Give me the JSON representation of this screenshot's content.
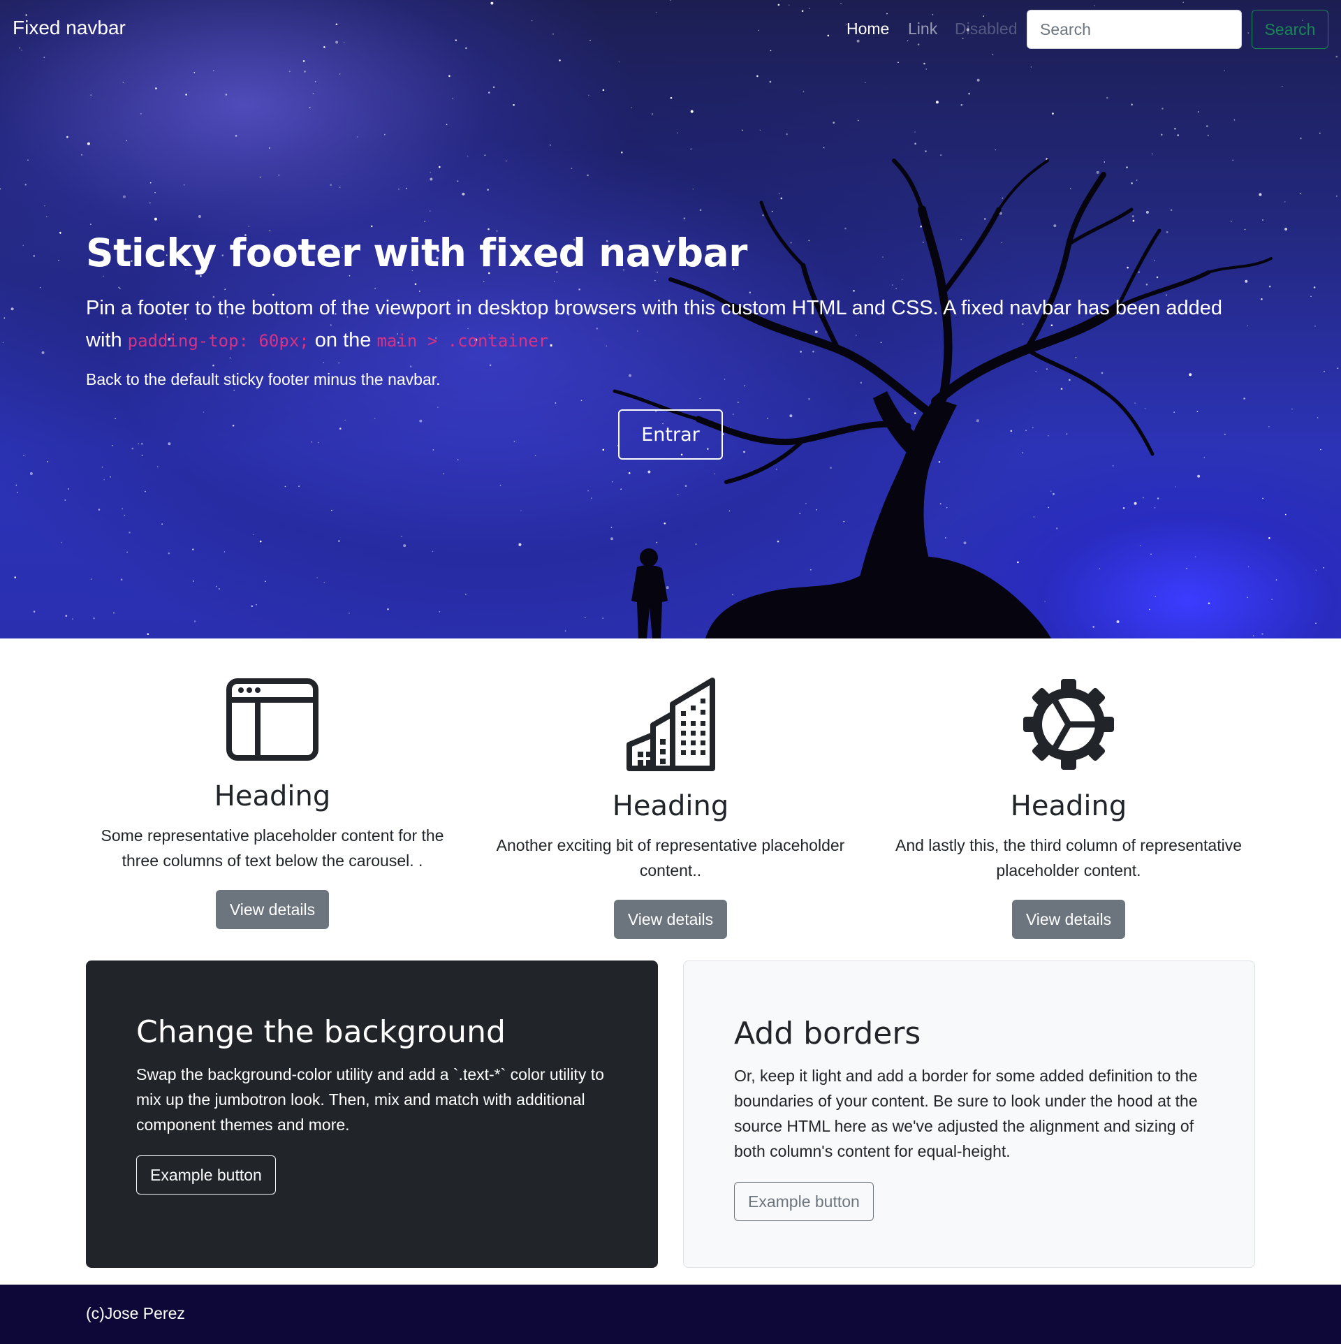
{
  "navbar": {
    "brand": "Fixed navbar",
    "links": [
      {
        "label": "Home",
        "state": "active"
      },
      {
        "label": "Link",
        "state": "normal"
      },
      {
        "label": "Disabled",
        "state": "disabled"
      }
    ],
    "search_placeholder": "Search",
    "search_button": "Search"
  },
  "hero": {
    "title": "Sticky footer with fixed navbar",
    "lead_before": "Pin a footer to the bottom of the viewport in desktop browsers with this custom HTML and CSS. A fixed navbar has been added with ",
    "code1": "padding-top: 60px;",
    "lead_middle": " on the ",
    "code2": "main > .container",
    "lead_after": ".",
    "small_text": "Back to the default sticky footer minus the navbar.",
    "button": "Entrar"
  },
  "features": [
    {
      "icon": "browser-window-icon",
      "heading": "Heading",
      "text": "Some representative placeholder content for the three columns of text below the carousel. .",
      "button": "View details"
    },
    {
      "icon": "building-icon",
      "heading": "Heading",
      "text": "Another exciting bit of representative placeholder content..",
      "button": "View details"
    },
    {
      "icon": "gear-icon",
      "heading": "Heading",
      "text": "And lastly this, the third column of representative placeholder content.",
      "button": "View details"
    }
  ],
  "cards": {
    "dark": {
      "title": "Change the background",
      "text": "Swap the background-color utility and add a `.text-*` color utility to mix up the jumbotron look. Then, mix and match with additional component themes and more.",
      "button": "Example button"
    },
    "light": {
      "title": "Add borders",
      "text": "Or, keep it light and add a border for some added definition to the boundaries of your content. Be sure to look under the hood at the source HTML here as we've adjusted the alignment and sizing of both column's content for equal-height.",
      "button": "Example button"
    }
  },
  "footer": {
    "text": "(c)Jose Perez"
  },
  "colors": {
    "footer_bg": "#0e0838",
    "dark_card_bg": "#212529",
    "secondary_button": "#6c757d",
    "success_outline": "#198754",
    "code_pink": "#d63384"
  }
}
